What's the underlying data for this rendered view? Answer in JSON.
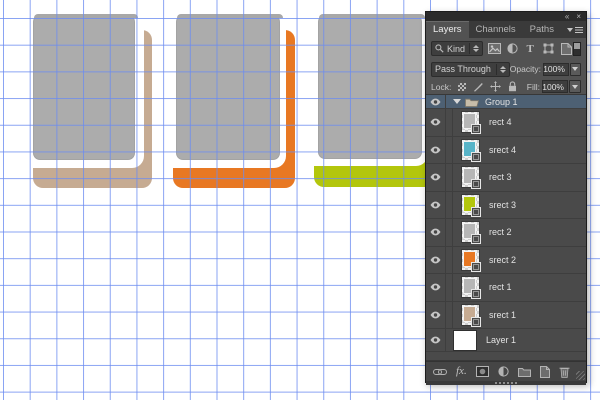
{
  "canvas": {
    "background": "#ffffff",
    "grid_color": "rgba(108,140,240,0.8)",
    "card_fill": "#acacac",
    "cards": [
      {
        "id": "card-1",
        "accent": "#c6ab92"
      },
      {
        "id": "card-2",
        "accent": "#e87823"
      },
      {
        "id": "card-3",
        "accent": "#b3c60c"
      }
    ]
  },
  "panel": {
    "header_icons": [
      "collapse-panel-icon",
      "close-panel-icon"
    ],
    "collapse_glyph": "«",
    "close_glyph": "×",
    "tabs": [
      {
        "label": "Layers",
        "active": true
      },
      {
        "label": "Channels",
        "active": false
      },
      {
        "label": "Paths",
        "active": false
      }
    ],
    "filter": {
      "kind_label": "Kind",
      "type_icons": [
        "pixel-layer-filter-icon",
        "adjustment-layer-filter-icon",
        "type-layer-filter-icon",
        "shape-layer-filter-icon",
        "smart-object-filter-icon"
      ],
      "type_glyph": "T"
    },
    "blend": {
      "mode": "Pass Through",
      "opacity_label": "Opacity:",
      "opacity_value": "100%"
    },
    "lock": {
      "label": "Lock:",
      "icons": [
        "lock-transparency-icon",
        "lock-pixels-icon",
        "lock-position-icon",
        "lock-all-icon"
      ],
      "fill_label": "Fill:",
      "fill_value": "100%"
    },
    "layers": [
      {
        "label": "Group 1",
        "type": "group",
        "selected": true,
        "expanded": true,
        "in_group": false
      },
      {
        "label": "rect 4",
        "type": "shape",
        "in_group": true,
        "thumb_color": "#b6b6b6"
      },
      {
        "label": "srect 4",
        "type": "shape",
        "in_group": true,
        "thumb_color": "#58b4c8"
      },
      {
        "label": "rect 3",
        "type": "shape",
        "in_group": true,
        "thumb_color": "#b6b6b6"
      },
      {
        "label": "srect 3",
        "type": "shape",
        "in_group": true,
        "thumb_color": "#b3c60c"
      },
      {
        "label": "rect 2",
        "type": "shape",
        "in_group": true,
        "thumb_color": "#b6b6b6"
      },
      {
        "label": "srect 2",
        "type": "shape",
        "in_group": true,
        "thumb_color": "#e87823"
      },
      {
        "label": "rect 1",
        "type": "shape",
        "in_group": true,
        "thumb_color": "#b6b6b6"
      },
      {
        "label": "srect 1",
        "type": "shape",
        "in_group": true,
        "thumb_color": "#c6ab92"
      },
      {
        "label": "Layer 1",
        "type": "pixel",
        "in_group": false,
        "thumb_color": "#ffffff"
      }
    ],
    "bottom_icons": [
      "link-layers-icon",
      "layer-styles-icon",
      "layer-mask-icon",
      "adjustment-layer-icon",
      "new-group-icon",
      "new-layer-icon",
      "delete-layer-icon"
    ],
    "fx_label": "fx."
  }
}
